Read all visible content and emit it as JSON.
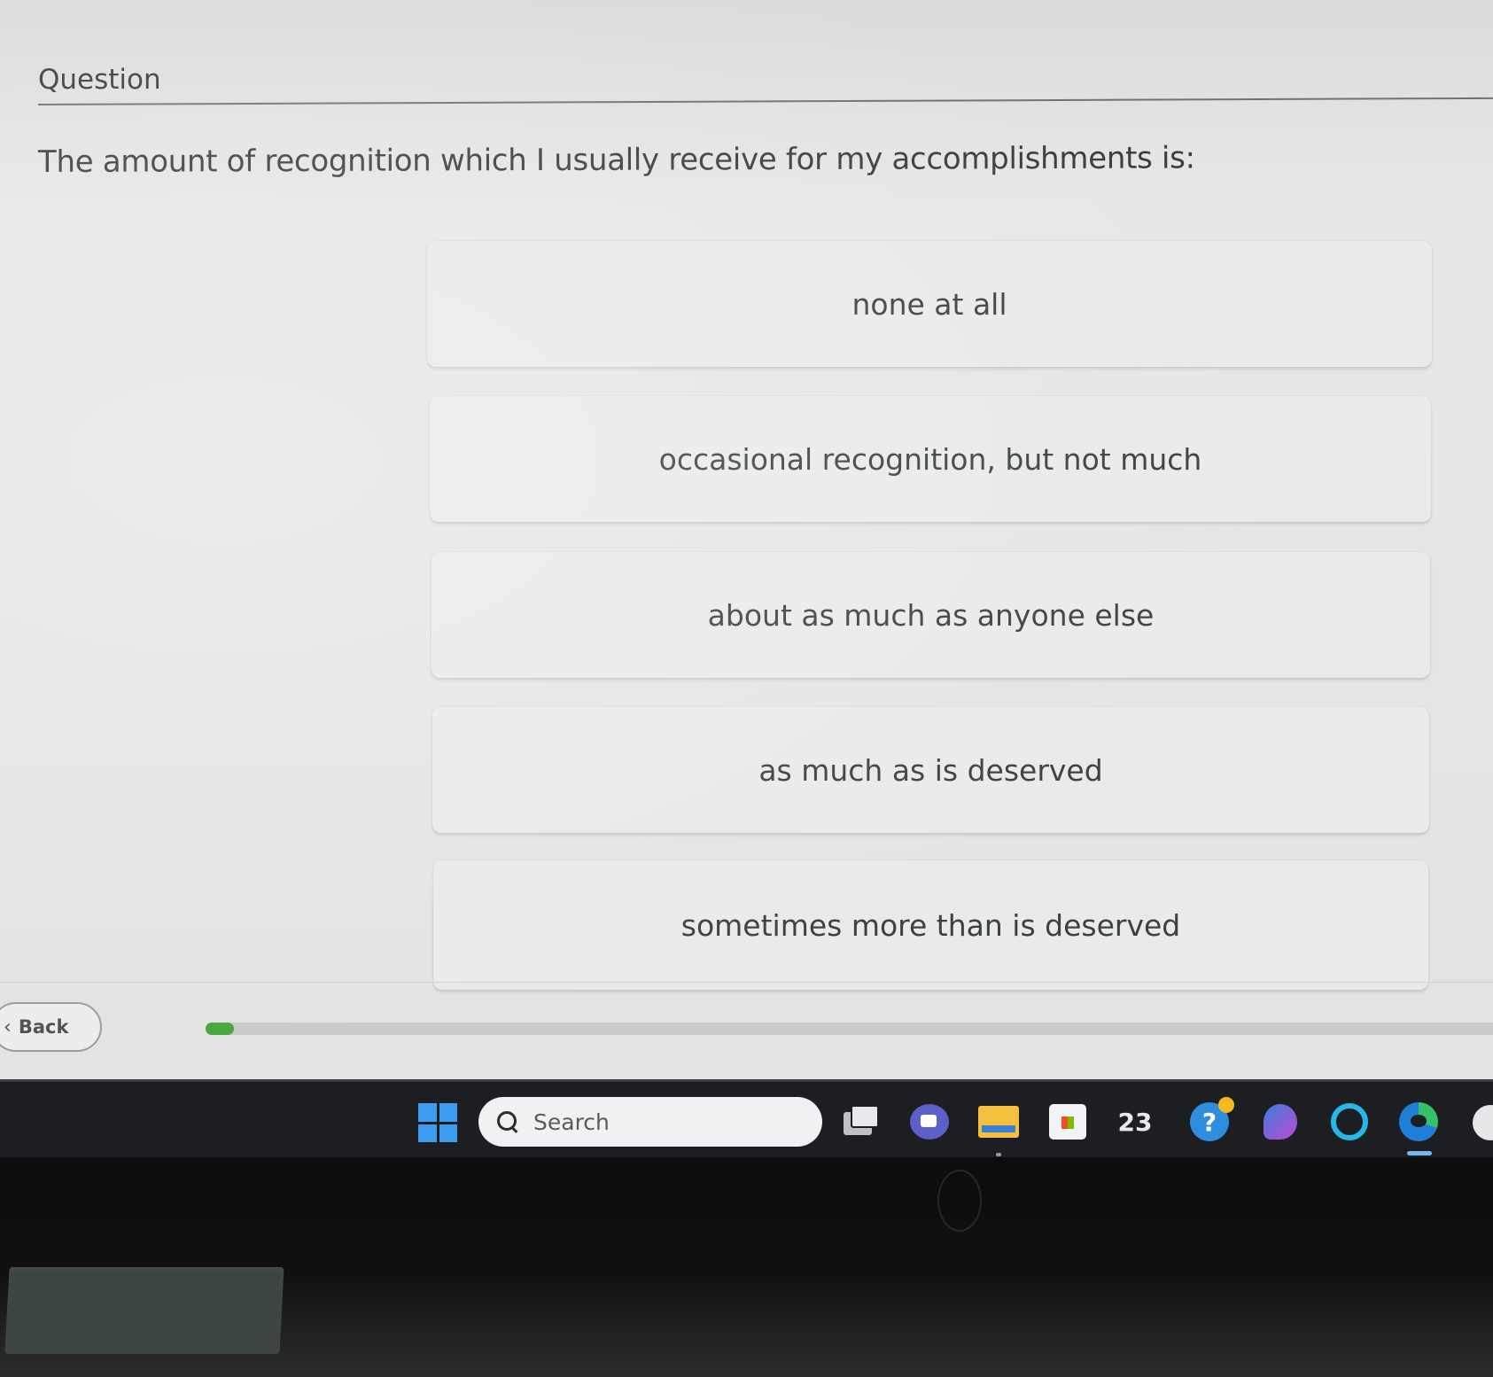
{
  "question": {
    "header": "Question",
    "text": "The amount of recognition which I usually receive for my accomplishments is:"
  },
  "options": [
    "none at all",
    "occasional recognition, but not much",
    "about as much as anyone else",
    "as much as is deserved",
    "sometimes more than is deserved"
  ],
  "footer": {
    "back_label": "Back",
    "progress_fraction": 0.02,
    "progress_color": "#4aa640"
  },
  "taskbar": {
    "search_label": "Search",
    "calendar_badge": "23",
    "help_glyph": "?",
    "icons": [
      "windows-start-icon",
      "search-icon",
      "task-view-icon",
      "meet-icon",
      "file-explorer-icon",
      "store-icon",
      "calendar-icon",
      "help-icon",
      "pen-app-icon",
      "cortana-icon",
      "edge-icon"
    ]
  }
}
